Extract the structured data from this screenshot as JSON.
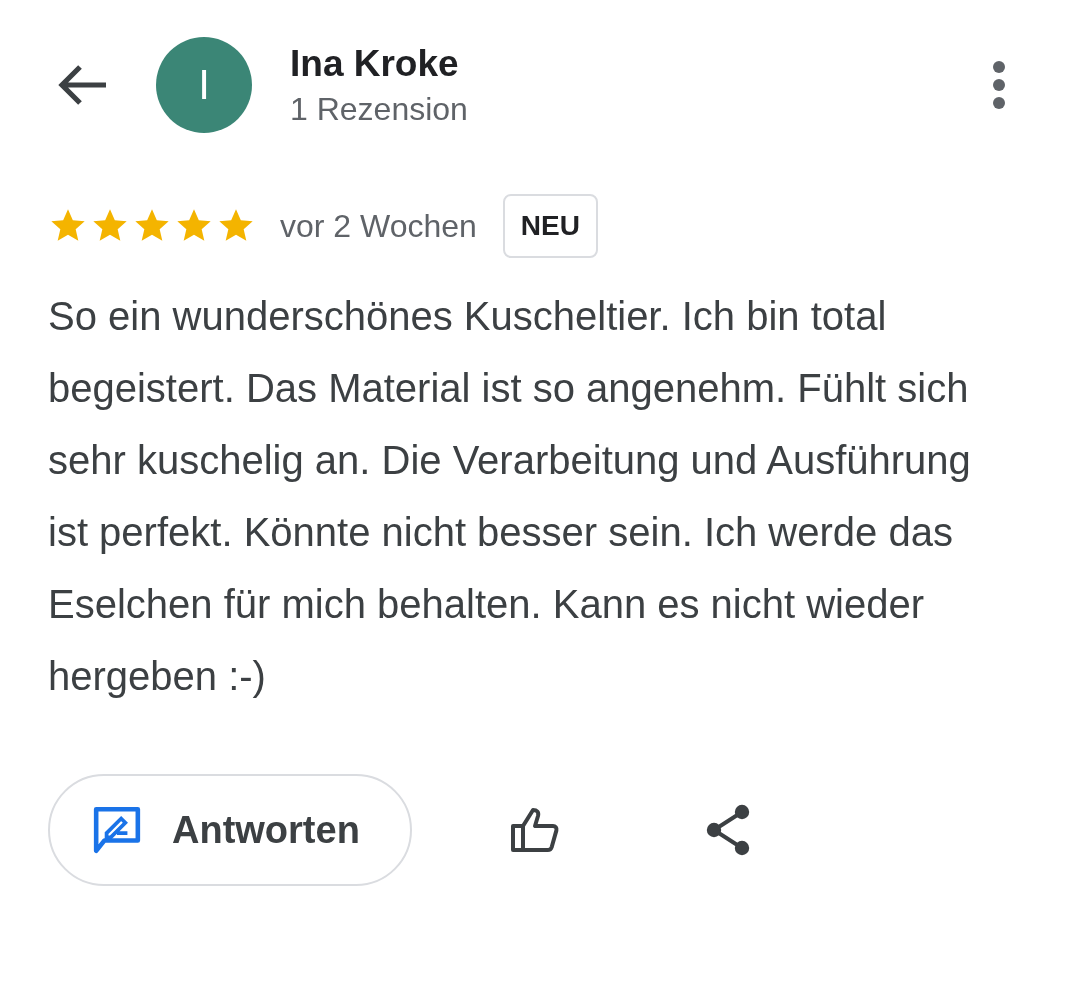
{
  "header": {
    "avatar_letter": "I",
    "name": "Ina Kroke",
    "subtitle": "1 Rezension"
  },
  "review": {
    "stars": 5,
    "time": "vor 2 Wochen",
    "badge": "NEU",
    "text": "So ein wunderschönes Kuscheltier. Ich bin total begeistert. Das Material ist so angenehm. Fühlt sich sehr kuschelig an. Die Verarbeitung und Ausführung ist perfekt. Könnte nicht besser sein. Ich werde das Eselchen für mich behalten. Kann es nicht wieder hergeben :-)"
  },
  "actions": {
    "reply_label": "Antworten"
  }
}
